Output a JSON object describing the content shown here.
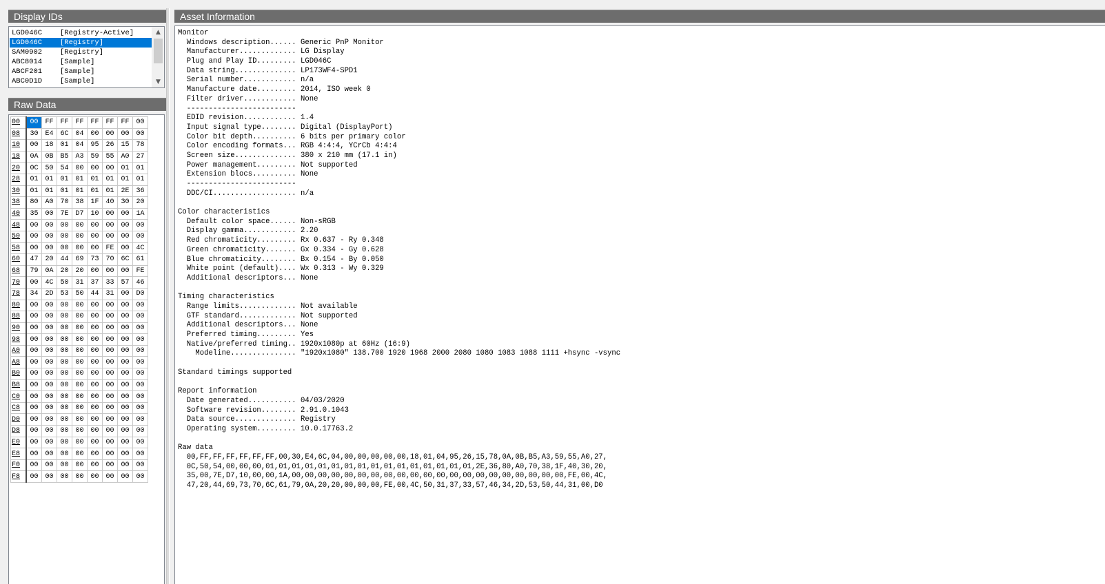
{
  "headers": {
    "display_ids": "Display IDs",
    "raw_data": "Raw Data",
    "asset_info": "Asset Information"
  },
  "display_ids": [
    {
      "id": "LGD046C",
      "source": "[Registry-Active]",
      "selected": false
    },
    {
      "id": "LGD046C",
      "source": "[Registry]",
      "selected": true
    },
    {
      "id": "SAM0902",
      "source": "[Registry]",
      "selected": false
    },
    {
      "id": "ABC8014",
      "source": "[Sample]",
      "selected": false
    },
    {
      "id": "ABCF201",
      "source": "[Sample]",
      "selected": false
    },
    {
      "id": "ABC0D1D",
      "source": "[Sample]",
      "selected": false
    }
  ],
  "scroll_icons": {
    "up": "chevron-up-icon",
    "down": "chevron-down-icon"
  },
  "raw_data": [
    {
      "offset": "00",
      "bytes": [
        "00",
        "FF",
        "FF",
        "FF",
        "FF",
        "FF",
        "FF",
        "00"
      ]
    },
    {
      "offset": "08",
      "bytes": [
        "30",
        "E4",
        "6C",
        "04",
        "00",
        "00",
        "00",
        "00"
      ]
    },
    {
      "offset": "10",
      "bytes": [
        "00",
        "18",
        "01",
        "04",
        "95",
        "26",
        "15",
        "78"
      ]
    },
    {
      "offset": "18",
      "bytes": [
        "0A",
        "0B",
        "B5",
        "A3",
        "59",
        "55",
        "A0",
        "27"
      ]
    },
    {
      "offset": "20",
      "bytes": [
        "0C",
        "50",
        "54",
        "00",
        "00",
        "00",
        "01",
        "01"
      ]
    },
    {
      "offset": "28",
      "bytes": [
        "01",
        "01",
        "01",
        "01",
        "01",
        "01",
        "01",
        "01"
      ]
    },
    {
      "offset": "30",
      "bytes": [
        "01",
        "01",
        "01",
        "01",
        "01",
        "01",
        "2E",
        "36"
      ]
    },
    {
      "offset": "38",
      "bytes": [
        "80",
        "A0",
        "70",
        "38",
        "1F",
        "40",
        "30",
        "20"
      ]
    },
    {
      "offset": "40",
      "bytes": [
        "35",
        "00",
        "7E",
        "D7",
        "10",
        "00",
        "00",
        "1A"
      ]
    },
    {
      "offset": "48",
      "bytes": [
        "00",
        "00",
        "00",
        "00",
        "00",
        "00",
        "00",
        "00"
      ]
    },
    {
      "offset": "50",
      "bytes": [
        "00",
        "00",
        "00",
        "00",
        "00",
        "00",
        "00",
        "00"
      ]
    },
    {
      "offset": "58",
      "bytes": [
        "00",
        "00",
        "00",
        "00",
        "00",
        "FE",
        "00",
        "4C"
      ]
    },
    {
      "offset": "60",
      "bytes": [
        "47",
        "20",
        "44",
        "69",
        "73",
        "70",
        "6C",
        "61"
      ]
    },
    {
      "offset": "68",
      "bytes": [
        "79",
        "0A",
        "20",
        "20",
        "00",
        "00",
        "00",
        "FE"
      ]
    },
    {
      "offset": "70",
      "bytes": [
        "00",
        "4C",
        "50",
        "31",
        "37",
        "33",
        "57",
        "46"
      ]
    },
    {
      "offset": "78",
      "bytes": [
        "34",
        "2D",
        "53",
        "50",
        "44",
        "31",
        "00",
        "D0"
      ]
    },
    {
      "offset": "80",
      "bytes": [
        "00",
        "00",
        "00",
        "00",
        "00",
        "00",
        "00",
        "00"
      ]
    },
    {
      "offset": "88",
      "bytes": [
        "00",
        "00",
        "00",
        "00",
        "00",
        "00",
        "00",
        "00"
      ]
    },
    {
      "offset": "90",
      "bytes": [
        "00",
        "00",
        "00",
        "00",
        "00",
        "00",
        "00",
        "00"
      ]
    },
    {
      "offset": "98",
      "bytes": [
        "00",
        "00",
        "00",
        "00",
        "00",
        "00",
        "00",
        "00"
      ]
    },
    {
      "offset": "A0",
      "bytes": [
        "00",
        "00",
        "00",
        "00",
        "00",
        "00",
        "00",
        "00"
      ]
    },
    {
      "offset": "A8",
      "bytes": [
        "00",
        "00",
        "00",
        "00",
        "00",
        "00",
        "00",
        "00"
      ]
    },
    {
      "offset": "B0",
      "bytes": [
        "00",
        "00",
        "00",
        "00",
        "00",
        "00",
        "00",
        "00"
      ]
    },
    {
      "offset": "B8",
      "bytes": [
        "00",
        "00",
        "00",
        "00",
        "00",
        "00",
        "00",
        "00"
      ]
    },
    {
      "offset": "C0",
      "bytes": [
        "00",
        "00",
        "00",
        "00",
        "00",
        "00",
        "00",
        "00"
      ]
    },
    {
      "offset": "C8",
      "bytes": [
        "00",
        "00",
        "00",
        "00",
        "00",
        "00",
        "00",
        "00"
      ]
    },
    {
      "offset": "D0",
      "bytes": [
        "00",
        "00",
        "00",
        "00",
        "00",
        "00",
        "00",
        "00"
      ]
    },
    {
      "offset": "D8",
      "bytes": [
        "00",
        "00",
        "00",
        "00",
        "00",
        "00",
        "00",
        "00"
      ]
    },
    {
      "offset": "E0",
      "bytes": [
        "00",
        "00",
        "00",
        "00",
        "00",
        "00",
        "00",
        "00"
      ]
    },
    {
      "offset": "E8",
      "bytes": [
        "00",
        "00",
        "00",
        "00",
        "00",
        "00",
        "00",
        "00"
      ]
    },
    {
      "offset": "F0",
      "bytes": [
        "00",
        "00",
        "00",
        "00",
        "00",
        "00",
        "00",
        "00"
      ]
    },
    {
      "offset": "F8",
      "bytes": [
        "00",
        "00",
        "00",
        "00",
        "00",
        "00",
        "00",
        "00"
      ]
    }
  ],
  "asset_info_lines": [
    "Monitor",
    "  Windows description...... Generic PnP Monitor",
    "  Manufacturer............. LG Display",
    "  Plug and Play ID......... LGD046C",
    "  Data string.............. LP173WF4-SPD1",
    "  Serial number............ n/a",
    "  Manufacture date......... 2014, ISO week 0",
    "  Filter driver............ None",
    "  -------------------------",
    "  EDID revision............ 1.4",
    "  Input signal type........ Digital (DisplayPort)",
    "  Color bit depth.......... 6 bits per primary color",
    "  Color encoding formats... RGB 4:4:4, YCrCb 4:4:4",
    "  Screen size.............. 380 x 210 mm (17.1 in)",
    "  Power management......... Not supported",
    "  Extension blocs.......... None",
    "  -------------------------",
    "  DDC/CI................... n/a",
    "",
    "Color characteristics",
    "  Default color space...... Non-sRGB",
    "  Display gamma............ 2.20",
    "  Red chromaticity......... Rx 0.637 - Ry 0.348",
    "  Green chromaticity....... Gx 0.334 - Gy 0.628",
    "  Blue chromaticity........ Bx 0.154 - By 0.050",
    "  White point (default).... Wx 0.313 - Wy 0.329",
    "  Additional descriptors... None",
    "",
    "Timing characteristics",
    "  Range limits............. Not available",
    "  GTF standard............. Not supported",
    "  Additional descriptors... None",
    "  Preferred timing......... Yes",
    "  Native/preferred timing.. 1920x1080p at 60Hz (16:9)",
    "    Modeline............... \"1920x1080\" 138.700 1920 1968 2000 2080 1080 1083 1088 1111 +hsync -vsync",
    "",
    "Standard timings supported",
    "",
    "Report information",
    "  Date generated........... 04/03/2020",
    "  Software revision........ 2.91.0.1043",
    "  Data source.............. Registry",
    "  Operating system......... 10.0.17763.2",
    "",
    "Raw data",
    "  00,FF,FF,FF,FF,FF,FF,00,30,E4,6C,04,00,00,00,00,00,18,01,04,95,26,15,78,0A,0B,B5,A3,59,55,A0,27,",
    "  0C,50,54,00,00,00,01,01,01,01,01,01,01,01,01,01,01,01,01,01,01,01,2E,36,80,A0,70,38,1F,40,30,20,",
    "  35,00,7E,D7,10,00,00,1A,00,00,00,00,00,00,00,00,00,00,00,00,00,00,00,00,00,00,00,00,00,FE,00,4C,",
    "  47,20,44,69,73,70,6C,61,79,0A,20,20,00,00,00,FE,00,4C,50,31,37,33,57,46,34,2D,53,50,44,31,00,D0"
  ]
}
